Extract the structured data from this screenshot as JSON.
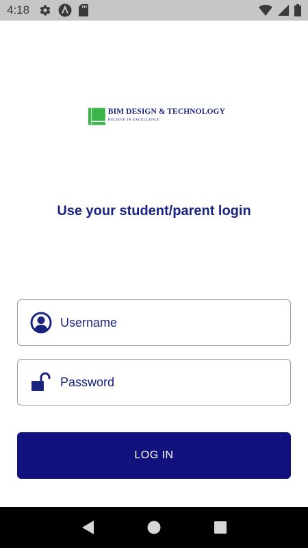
{
  "status_bar": {
    "time": "4:18",
    "icons": [
      "gear-icon",
      "android-a-icon",
      "sd-card-icon",
      "wifi-icon",
      "cellular-icon",
      "battery-icon"
    ],
    "color": "#c6c6c6"
  },
  "logo": {
    "name": "BIM DESIGN & TECHNOLOGY",
    "tagline": "BELIEVE IN EXCELLENCE",
    "mark_color": "#3cb54a"
  },
  "login": {
    "heading": "Use your student/parent login",
    "username": {
      "placeholder": "Username",
      "value": "",
      "icon": "user-icon"
    },
    "password": {
      "placeholder": "Password",
      "value": "",
      "icon": "unlock-icon"
    },
    "button_label": "LOG IN"
  },
  "nav_bar": {
    "buttons": [
      "back-icon",
      "home-icon",
      "recents-icon"
    ]
  },
  "colors": {
    "primary": "#12127e",
    "text_primary": "#1a237e",
    "border": "#9e9e9e"
  }
}
